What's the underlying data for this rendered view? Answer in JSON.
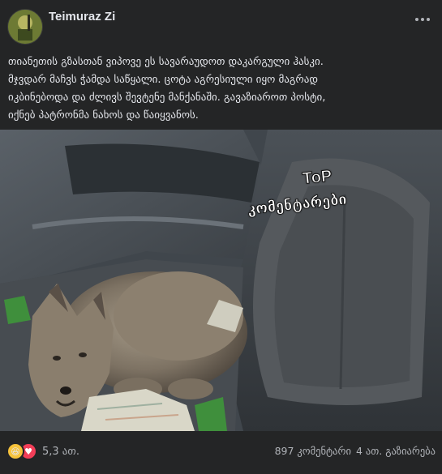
{
  "post": {
    "author": "Teimuraz Zi",
    "text_lines": [
      "თიანეთის გზასთან ვიპოვე ეს სავარაუდოთ დაკარგული ჰასკი.",
      "მჯვდარ მაჩვს ჭამდა საწყალი. ცოტა აგრესიული იყო მაგრად",
      "იკბინებოდა და ძლივს შევტენე მანქანაში. გავაზიაროთ პოსტი,",
      "იქნებ პატრონმა ნახოს და წაიყვანოს."
    ]
  },
  "overlay": {
    "line1": "ToP",
    "line2": "კომენტარები"
  },
  "footer": {
    "reaction_icons": [
      "haha-icon",
      "love-icon"
    ],
    "reaction_count": "5,3 ათ.",
    "comments": "897 კომენტარი",
    "shares": "4 ათ. გაზიარება"
  },
  "colors": {
    "background": "#242526",
    "text": "#e4e6eb",
    "secondary_text": "#b0b3b8",
    "haha": "#f7c33b",
    "love": "#f33e58"
  }
}
